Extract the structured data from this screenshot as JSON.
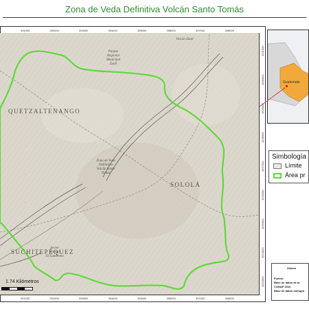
{
  "title": "Zona de Veda Definitiva Volcán Santo Tomás",
  "map": {
    "x_ticks_top": [
      "391000",
      "392000",
      "393000",
      "394000",
      "395000",
      "396000",
      "397000",
      "398000"
    ],
    "x_ticks_bottom": [
      "391000",
      "392000",
      "393000",
      "394000",
      "395000",
      "396000",
      "397000",
      "398000"
    ],
    "y_ticks_right": [
      "1631000",
      "1630000",
      "1629000",
      "1628000",
      "1627000",
      "1626000",
      "1625000",
      "1624000",
      "1623000"
    ],
    "regions": {
      "quetzaltenango": "QUETZALTENANGO",
      "solola": "SOLOLÁ",
      "suchitepequez": "SUCHITEPÉQUEZ"
    },
    "features": {
      "parque": "Parque\nRegional\nMunicipal\nZunil",
      "volcan": "Zona de Veda\nDefinitiva\nVolcán Santo\nTomás",
      "volcan_zunil": "Volcán Zunil",
      "finca": "Sector\nPalmar\nEl Lumbreno"
    },
    "scale_label": "1.74 Kilómetros",
    "protected_area_color": "#5fd93a",
    "terrain_color": "#dcd7cc"
  },
  "legend": {
    "title": "Simbología",
    "items": [
      {
        "label": "Límite",
        "color": "#e8e8e8",
        "border": "#777777"
      },
      {
        "label": "Área pr",
        "color": "#ffffff",
        "border": "#5fd93a"
      }
    ]
  },
  "inset": {
    "label": "Guatemala",
    "highlight_color": "#f2a93b"
  },
  "info": {
    "title": "Sistem",
    "source_label": "Fuente:",
    "line1": "Base de datos de la",
    "line2": "CONAP 2016",
    "line3": "Base de datos cartogra"
  }
}
